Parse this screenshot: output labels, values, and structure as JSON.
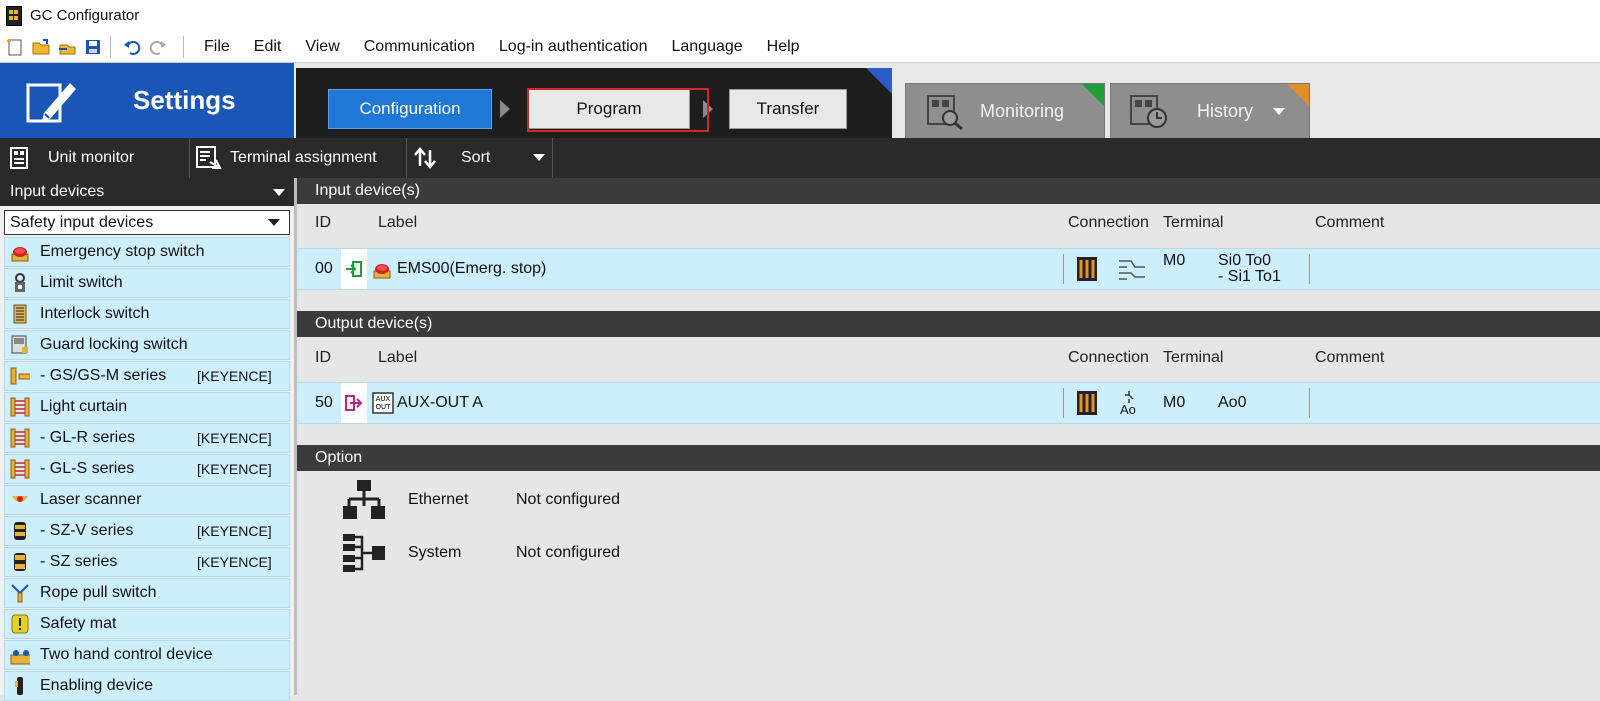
{
  "window": {
    "title": "GC Configurator"
  },
  "menu": {
    "items": [
      {
        "label": "File"
      },
      {
        "label": "Edit"
      },
      {
        "label": "View"
      },
      {
        "label": "Communication"
      },
      {
        "label": "Log-in authentication"
      },
      {
        "label": "Language"
      },
      {
        "label": "Help"
      }
    ]
  },
  "header": {
    "settings_label": "Settings",
    "steps": [
      {
        "label": "Configuration",
        "state": "active"
      },
      {
        "label": "Program",
        "state": "normal"
      },
      {
        "label": "Transfer",
        "state": "normal"
      }
    ],
    "mode_tabs": [
      {
        "label": "Monitoring",
        "corner_color": "#1e9e3a"
      },
      {
        "label": "History",
        "corner_color": "#e0902a"
      }
    ]
  },
  "toolbar": {
    "unit_monitor": "Unit monitor",
    "terminal_assignment": "Terminal assignment",
    "sort": "Sort"
  },
  "left_panel": {
    "header": "Input devices",
    "selected_category": "Safety input devices",
    "items": [
      {
        "label": "Emergency stop switch",
        "tag": "",
        "icon": "estop-icon"
      },
      {
        "label": "Limit switch",
        "tag": "",
        "icon": "limit-switch-icon"
      },
      {
        "label": "Interlock switch",
        "tag": "",
        "icon": "interlock-icon"
      },
      {
        "label": "Guard locking switch",
        "tag": "",
        "icon": "guard-lock-icon"
      },
      {
        "label": "- GS/GS-M series",
        "tag": "[KEYENCE]",
        "icon": "gs-sensor-icon"
      },
      {
        "label": "Light curtain",
        "tag": "",
        "icon": "light-curtain-icon"
      },
      {
        "label": "- GL-R series",
        "tag": "[KEYENCE]",
        "icon": "light-curtain-icon"
      },
      {
        "label": "- GL-S series",
        "tag": "[KEYENCE]",
        "icon": "light-curtain-icon"
      },
      {
        "label": "Laser scanner",
        "tag": "",
        "icon": "laser-scanner-icon"
      },
      {
        "label": "- SZ-V series",
        "tag": "[KEYENCE]",
        "icon": "scanner-sz-icon"
      },
      {
        "label": "- SZ series",
        "tag": "[KEYENCE]",
        "icon": "scanner-sz-icon"
      },
      {
        "label": "Rope pull switch",
        "tag": "",
        "icon": "rope-pull-icon"
      },
      {
        "label": "Safety mat",
        "tag": "",
        "icon": "safety-mat-icon"
      },
      {
        "label": "Two hand control device",
        "tag": "",
        "icon": "two-hand-icon"
      },
      {
        "label": "Enabling device",
        "tag": "",
        "icon": "enabling-device-icon"
      }
    ]
  },
  "input_section": {
    "title": "Input device(s)",
    "columns": {
      "id": "ID",
      "label": "Label",
      "connection": "Connection",
      "terminal": "Terminal",
      "comment": "Comment"
    },
    "rows": [
      {
        "id": "00",
        "label": "EMS00(Emerg. stop)",
        "module": "M0",
        "terminal_1": "Si0 To0",
        "terminal_2": "- Si1 To1",
        "comment": ""
      }
    ]
  },
  "output_section": {
    "title": "Output device(s)",
    "columns": {
      "id": "ID",
      "label": "Label",
      "connection": "Connection",
      "terminal": "Terminal",
      "comment": "Comment"
    },
    "rows": [
      {
        "id": "50",
        "label": "AUX-OUT A",
        "connection_text": "Ao",
        "module": "M0",
        "terminal_1": "Ao0",
        "comment": ""
      }
    ]
  },
  "option_section": {
    "title": "Option",
    "rows": [
      {
        "label": "Ethernet",
        "value": "Not configured"
      },
      {
        "label": "System",
        "value": "Not configured"
      }
    ]
  }
}
